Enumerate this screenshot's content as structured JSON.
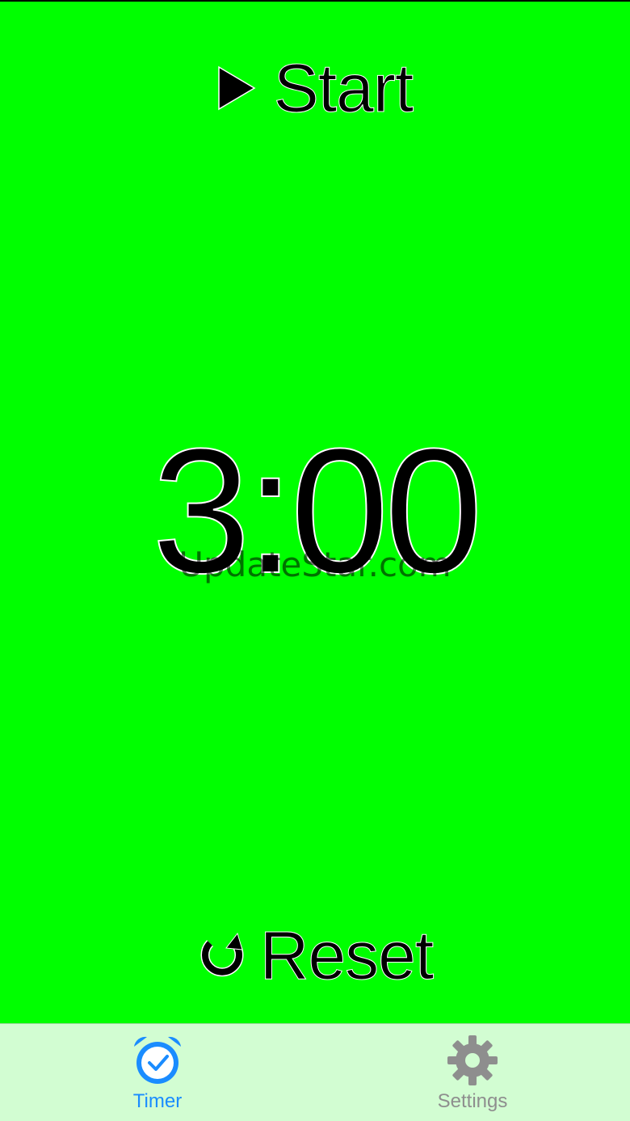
{
  "controls": {
    "start_label": "Start",
    "reset_label": "Reset"
  },
  "timer": {
    "display": "3:00"
  },
  "watermark": "UpdateStar.com",
  "tab_bar": {
    "tabs": [
      {
        "label": "Timer",
        "icon": "alarm-clock-icon",
        "active": true
      },
      {
        "label": "Settings",
        "icon": "gear-icon",
        "active": false
      }
    ]
  },
  "colors": {
    "background": "#00ff00",
    "tab_bar": "#d2fdd2",
    "active_tab": "#1a8cff",
    "inactive_tab": "#8e8e8e"
  }
}
